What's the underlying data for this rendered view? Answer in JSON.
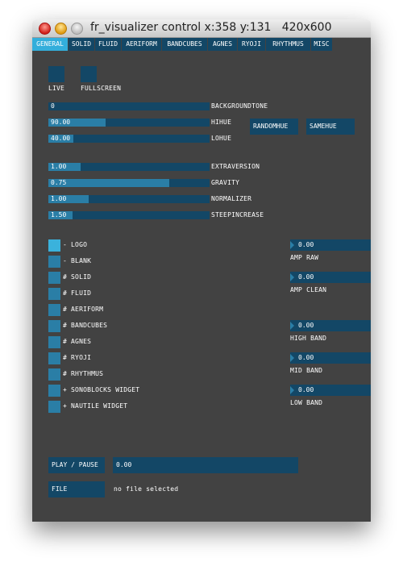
{
  "window": {
    "title": "fr_visualizer control x:358 y:131   420x600"
  },
  "tabs": [
    {
      "label": "GENERAL",
      "active": true
    },
    {
      "label": "SOLID"
    },
    {
      "label": "FLUID"
    },
    {
      "label": "AERIFORM"
    },
    {
      "label": "BANDCUBES"
    },
    {
      "label": "AGNES"
    },
    {
      "label": "RYOJI"
    },
    {
      "label": "RHYTHMUS"
    },
    {
      "label": "MISC"
    }
  ],
  "toggles": [
    {
      "label": "LIVE",
      "on": false
    },
    {
      "label": "FULLSCREEN",
      "on": false
    }
  ],
  "sliders_hue": [
    {
      "label": "BACKGROUNDTONE",
      "value": "0",
      "fraction": 0.0
    },
    {
      "label": "HIHUE",
      "value": "90.00",
      "fraction": 0.353
    },
    {
      "label": "LOHUE",
      "value": "40.00",
      "fraction": 0.157
    }
  ],
  "hue_buttons": {
    "random": "RANDOMHUE",
    "same": "SAMEHUE"
  },
  "sliders_physics": [
    {
      "label": "EXTRAVERSION",
      "value": "1.00",
      "fraction": 0.2
    },
    {
      "label": "GRAVITY",
      "value": "0.75",
      "fraction": 0.75
    },
    {
      "label": "NORMALIZER",
      "value": "1.00",
      "fraction": 0.25
    },
    {
      "label": "STEEPINCREASE",
      "value": "1.50",
      "fraction": 0.15
    }
  ],
  "layers": [
    {
      "label": "- LOGO",
      "checked": true
    },
    {
      "label": "- BLANK",
      "checked": false
    },
    {
      "label": "# SOLID",
      "checked": false
    },
    {
      "label": "# FLUID",
      "checked": false
    },
    {
      "label": "# AERIFORM",
      "checked": false
    },
    {
      "label": "# BANDCUBES",
      "checked": false
    },
    {
      "label": "# AGNES",
      "checked": false
    },
    {
      "label": "# RYOJI",
      "checked": false
    },
    {
      "label": "# RHYTHMUS",
      "checked": false
    },
    {
      "label": "+ SONOBLOCKS WIDGET",
      "checked": false
    },
    {
      "label": "+ NAUTILE WIDGET",
      "checked": false
    }
  ],
  "meters": [
    {
      "label": "AMP RAW",
      "value": "0.00"
    },
    {
      "label": "AMP CLEAN",
      "value": "0.00"
    },
    {
      "label": "HIGH BAND",
      "value": "0.00"
    },
    {
      "label": "MID BAND",
      "value": "0.00"
    },
    {
      "label": "LOW BAND",
      "value": "0.00"
    }
  ],
  "player": {
    "play_label": "PLAY / PAUSE",
    "position": "0.00",
    "file_label": "FILE",
    "file_status": "no file selected"
  },
  "colors": {
    "accent": "#33aedb",
    "control": "#134766",
    "fill": "#2a7ea6",
    "background": "#424242"
  }
}
